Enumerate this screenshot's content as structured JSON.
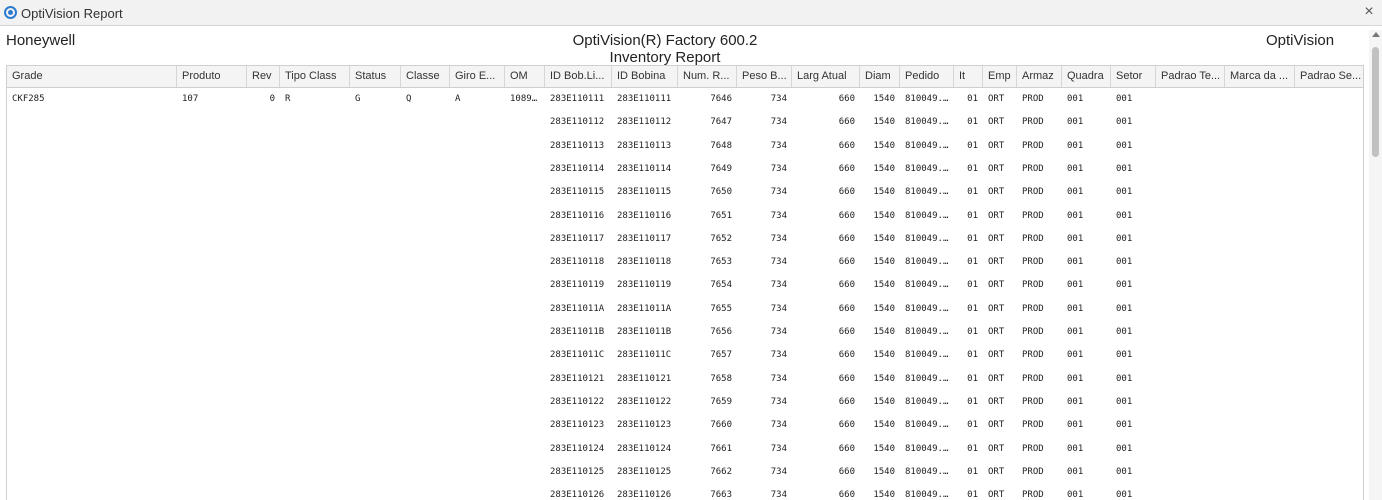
{
  "window": {
    "title": "OptiVision Report",
    "close_glyph": "×",
    "icon": "app-logo-icon",
    "accent": "#2d7bd1"
  },
  "report": {
    "left_header": "Honeywell",
    "title_line1": "OptiVision(R) Factory 600.2",
    "title_line2": "Inventory Report",
    "right_header": "OptiVision"
  },
  "columns": [
    "Grade",
    "Produto",
    "Rev",
    "Tipo Class",
    "Status",
    "Classe",
    "Giro E...",
    "OM",
    "ID Bob.Li...",
    "ID Bobina",
    "Num. R...",
    "Peso B...",
    "Larg Atual",
    "Diam",
    "Pedido",
    "It",
    "Emp",
    "Armaz",
    "Quadra",
    "Setor",
    "Padrao Te...",
    "Marca da ...",
    "Padrao Se..."
  ],
  "rows": [
    [
      "CKF285",
      "107",
      "0",
      "R",
      "G",
      "Q",
      "A",
      "1089...",
      "283E110111",
      "283E110111",
      "7646",
      "734",
      "660",
      "1540",
      "810049...",
      "01",
      "ORT",
      "PROD",
      "001",
      "001",
      "",
      "",
      ""
    ],
    [
      "",
      "",
      "",
      "",
      "",
      "",
      "",
      "",
      "283E110112",
      "283E110112",
      "7647",
      "734",
      "660",
      "1540",
      "810049...",
      "01",
      "ORT",
      "PROD",
      "001",
      "001",
      "",
      "",
      ""
    ],
    [
      "",
      "",
      "",
      "",
      "",
      "",
      "",
      "",
      "283E110113",
      "283E110113",
      "7648",
      "734",
      "660",
      "1540",
      "810049...",
      "01",
      "ORT",
      "PROD",
      "001",
      "001",
      "",
      "",
      ""
    ],
    [
      "",
      "",
      "",
      "",
      "",
      "",
      "",
      "",
      "283E110114",
      "283E110114",
      "7649",
      "734",
      "660",
      "1540",
      "810049...",
      "01",
      "ORT",
      "PROD",
      "001",
      "001",
      "",
      "",
      ""
    ],
    [
      "",
      "",
      "",
      "",
      "",
      "",
      "",
      "",
      "283E110115",
      "283E110115",
      "7650",
      "734",
      "660",
      "1540",
      "810049...",
      "01",
      "ORT",
      "PROD",
      "001",
      "001",
      "",
      "",
      ""
    ],
    [
      "",
      "",
      "",
      "",
      "",
      "",
      "",
      "",
      "283E110116",
      "283E110116",
      "7651",
      "734",
      "660",
      "1540",
      "810049...",
      "01",
      "ORT",
      "PROD",
      "001",
      "001",
      "",
      "",
      ""
    ],
    [
      "",
      "",
      "",
      "",
      "",
      "",
      "",
      "",
      "283E110117",
      "283E110117",
      "7652",
      "734",
      "660",
      "1540",
      "810049...",
      "01",
      "ORT",
      "PROD",
      "001",
      "001",
      "",
      "",
      ""
    ],
    [
      "",
      "",
      "",
      "",
      "",
      "",
      "",
      "",
      "283E110118",
      "283E110118",
      "7653",
      "734",
      "660",
      "1540",
      "810049...",
      "01",
      "ORT",
      "PROD",
      "001",
      "001",
      "",
      "",
      ""
    ],
    [
      "",
      "",
      "",
      "",
      "",
      "",
      "",
      "",
      "283E110119",
      "283E110119",
      "7654",
      "734",
      "660",
      "1540",
      "810049...",
      "01",
      "ORT",
      "PROD",
      "001",
      "001",
      "",
      "",
      ""
    ],
    [
      "",
      "",
      "",
      "",
      "",
      "",
      "",
      "",
      "283E11011A",
      "283E11011A",
      "7655",
      "734",
      "660",
      "1540",
      "810049...",
      "01",
      "ORT",
      "PROD",
      "001",
      "001",
      "",
      "",
      ""
    ],
    [
      "",
      "",
      "",
      "",
      "",
      "",
      "",
      "",
      "283E11011B",
      "283E11011B",
      "7656",
      "734",
      "660",
      "1540",
      "810049...",
      "01",
      "ORT",
      "PROD",
      "001",
      "001",
      "",
      "",
      ""
    ],
    [
      "",
      "",
      "",
      "",
      "",
      "",
      "",
      "",
      "283E11011C",
      "283E11011C",
      "7657",
      "734",
      "660",
      "1540",
      "810049...",
      "01",
      "ORT",
      "PROD",
      "001",
      "001",
      "",
      "",
      ""
    ],
    [
      "",
      "",
      "",
      "",
      "",
      "",
      "",
      "",
      "283E110121",
      "283E110121",
      "7658",
      "734",
      "660",
      "1540",
      "810049...",
      "01",
      "ORT",
      "PROD",
      "001",
      "001",
      "",
      "",
      ""
    ],
    [
      "",
      "",
      "",
      "",
      "",
      "",
      "",
      "",
      "283E110122",
      "283E110122",
      "7659",
      "734",
      "660",
      "1540",
      "810049...",
      "01",
      "ORT",
      "PROD",
      "001",
      "001",
      "",
      "",
      ""
    ],
    [
      "",
      "",
      "",
      "",
      "",
      "",
      "",
      "",
      "283E110123",
      "283E110123",
      "7660",
      "734",
      "660",
      "1540",
      "810049...",
      "01",
      "ORT",
      "PROD",
      "001",
      "001",
      "",
      "",
      ""
    ],
    [
      "",
      "",
      "",
      "",
      "",
      "",
      "",
      "",
      "283E110124",
      "283E110124",
      "7661",
      "734",
      "660",
      "1540",
      "810049...",
      "01",
      "ORT",
      "PROD",
      "001",
      "001",
      "",
      "",
      ""
    ],
    [
      "",
      "",
      "",
      "",
      "",
      "",
      "",
      "",
      "283E110125",
      "283E110125",
      "7662",
      "734",
      "660",
      "1540",
      "810049...",
      "01",
      "ORT",
      "PROD",
      "001",
      "001",
      "",
      "",
      ""
    ],
    [
      "",
      "",
      "",
      "",
      "",
      "",
      "",
      "",
      "283E110126",
      "283E110126",
      "7663",
      "734",
      "660",
      "1540",
      "810049...",
      "01",
      "ORT",
      "PROD",
      "001",
      "001",
      "",
      "",
      ""
    ]
  ]
}
